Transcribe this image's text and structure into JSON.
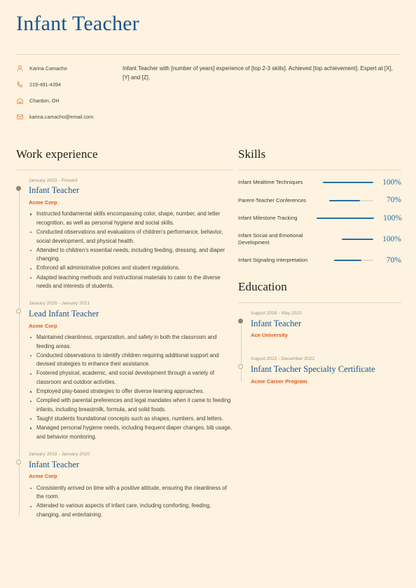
{
  "theme": {
    "background": "#fdf3e0",
    "accent_blue": "#1a5490",
    "accent_orange": "#e2561f",
    "icon_orange": "#e8833f",
    "rule": "#e3d7bf",
    "body_text": "#4a4237",
    "muted_text": "#9b9282"
  },
  "header": {
    "name_title": "Infant Teacher"
  },
  "contact": {
    "items": [
      {
        "icon": "person-icon",
        "text": "Karina Camacho"
      },
      {
        "icon": "phone-icon",
        "text": "219-491-4394"
      },
      {
        "icon": "building-icon",
        "text": "Chardon, OH"
      },
      {
        "icon": "email-icon",
        "text": "karina.camacho@email.com"
      }
    ]
  },
  "summary": {
    "text": "Infant Teacher with [number of years] experience of [top 2-3 skills]. Achieved [top achievement]. Expert at [X], [Y] and [Z]."
  },
  "work_experience": {
    "heading": "Work experience",
    "entries": [
      {
        "date": "January 2023 - Present",
        "title": "Infant Teacher",
        "org": "Acme Corp",
        "marker": "filled",
        "bullets": [
          "Instructed fundamental skills encompassing color, shape, number, and letter recognition, as well as personal hygiene and social skills.",
          "Conducted observations and evaluations of children's performance, behavior, social development, and physical health.",
          "Attended to children's essential needs, including feeding, dressing, and diaper changing.",
          "Enforced all administrative policies and student regulations.",
          "Adapted teaching methods and instructional materials to cater to the diverse needs and interests of students."
        ]
      },
      {
        "date": "January 2020 - January 2021",
        "title": "Lead Infant Teacher",
        "org": "Acme Corp",
        "marker": "hollow",
        "bullets": [
          "Maintained cleanliness, organization, and safety in both the classroom and feeding areas.",
          "Conducted observations to identify children requiring additional support and devised strategies to enhance their assistance.",
          "Fostered physical, academic, and social development through a variety of classroom and outdoor activities.",
          "Employed play-based strategies to offer diverse learning approaches.",
          "Complied with parental preferences and legal mandates when it came to feeding infants, including breastmilk, formula, and solid foods.",
          "Taught students foundational concepts such as shapes, numbers, and letters.",
          "Managed personal hygiene needs, including frequent diaper changes, bib usage, and behavior monitoring."
        ]
      },
      {
        "date": "January 2019 - January 2020",
        "title": "Infant Teacher",
        "org": "Acme Corp",
        "marker": "hollow",
        "bullets": [
          "Consistently arrived on time with a positive attitude, ensuring the cleanliness of the room.",
          "Attended to various aspects of infant care, including comforting, feeding, changing, and entertaining."
        ]
      }
    ]
  },
  "skills": {
    "heading": "Skills",
    "items": [
      {
        "name": "Infant Mealtime Techniques",
        "percent_label": "100%",
        "percent": 100
      },
      {
        "name": "Parent-Teacher Conferences",
        "percent_label": "70%",
        "percent": 70
      },
      {
        "name": "Infant Milestone Tracking",
        "percent_label": "100%",
        "percent": 100
      },
      {
        "name": "Infant Social and Emotional Development",
        "percent_label": "100%",
        "percent": 100
      },
      {
        "name": "Infant Signaling Interpretation",
        "percent_label": "70%",
        "percent": 70
      }
    ]
  },
  "education": {
    "heading": "Education",
    "entries": [
      {
        "date": "August 2018 - May 2022",
        "title": "Infant Teacher",
        "org": "Ace University",
        "marker": "filled"
      },
      {
        "date": "August 2022 - December 2022",
        "title": "Infant Teacher Specialty Certificate",
        "org": "Acme Career Program",
        "marker": "hollow"
      }
    ]
  }
}
